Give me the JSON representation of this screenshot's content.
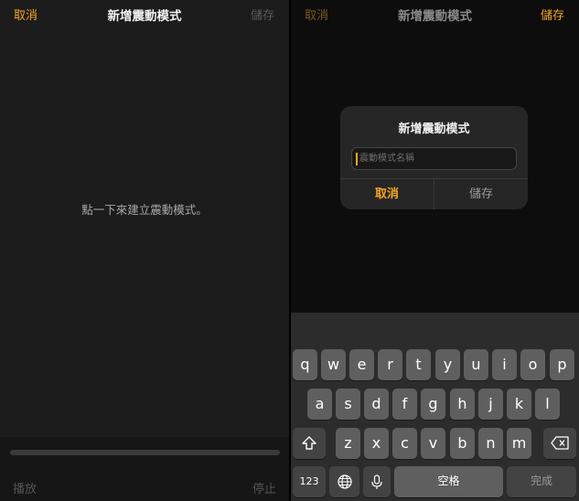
{
  "left": {
    "nav": {
      "cancel": "取消",
      "title": "新增震動模式",
      "save": "儲存"
    },
    "hint": "點一下來建立震動模式。",
    "controls": {
      "play": "播放",
      "stop": "停止"
    }
  },
  "right": {
    "nav": {
      "cancel": "取消",
      "title": "新增震動模式",
      "save": "儲存"
    },
    "alert": {
      "title": "新增震動模式",
      "placeholder": "震動模式名稱",
      "cancel": "取消",
      "save": "儲存"
    },
    "keyboard": {
      "row1": [
        "q",
        "w",
        "e",
        "r",
        "t",
        "y",
        "u",
        "i",
        "o",
        "p"
      ],
      "row2": [
        "a",
        "s",
        "d",
        "f",
        "g",
        "h",
        "j",
        "k",
        "l"
      ],
      "row3": [
        "z",
        "x",
        "c",
        "v",
        "b",
        "n",
        "m"
      ],
      "numbers": "123",
      "space": "空格",
      "done": "完成"
    }
  },
  "icons": {
    "shift": "shift-icon",
    "delete": "delete-icon",
    "globe": "globe-icon",
    "mic": "mic-icon"
  },
  "colors": {
    "accent": "#f5a623",
    "background": "#1c1c1c",
    "key": "#5f5f5f",
    "func_key": "#434343"
  }
}
